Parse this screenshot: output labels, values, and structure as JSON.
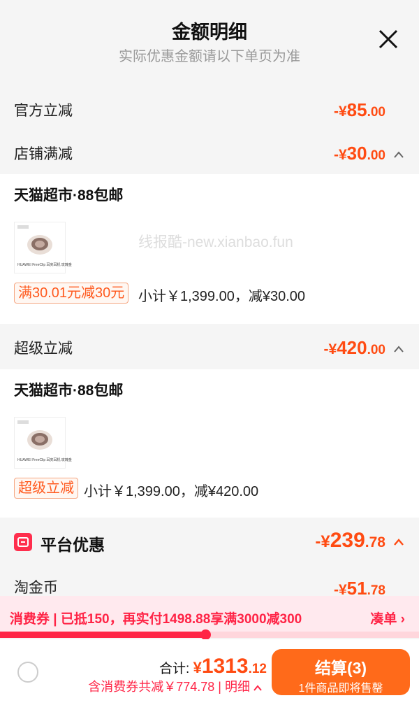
{
  "header": {
    "title": "金额明细",
    "subtitle": "实际优惠金额请以下单页为准"
  },
  "official_discount": {
    "label": "官方立减",
    "sym": "-¥",
    "int": "85",
    "dec": ".00"
  },
  "store_discount": {
    "label": "店铺满减",
    "sym": "-¥",
    "int": "30",
    "dec": ".00"
  },
  "store_panel": {
    "shop_name": "天猫超市·88包邮",
    "product_brand": "HUAWEI FreeClip 耳夹耳机 玫瑰金",
    "tag": "满30.01元减30元",
    "subtotal": "小计￥1,399.00，减¥30.00"
  },
  "super_discount": {
    "label": "超级立减",
    "sym": "-¥",
    "int": "420",
    "dec": ".00"
  },
  "super_panel": {
    "shop_name": "天猫超市·88包邮",
    "product_brand": "HUAWEI FreeClip 耳夹耳机 玫瑰金",
    "tag": "超级立减",
    "subtotal": "小计￥1,399.00，减¥420.00"
  },
  "platform": {
    "label": "平台优惠",
    "sym": "-¥",
    "int": "239",
    "dec": ".78",
    "coin_label": "淘金币",
    "coin_sym": "-¥",
    "coin_int": "51",
    "coin_dec": ".78"
  },
  "coupon_bar": {
    "text": "消费券 | 已抵150，再实付1498.88享满3000减300",
    "link": "凑单 ›",
    "progress": 0.49
  },
  "footer": {
    "total_label": "合计: ",
    "total_sym": "¥",
    "total_int": "1313",
    "total_dec": ".12",
    "saved": "含消费券共减￥774.78 | 明细",
    "checkout_label": "结算(3)",
    "checkout_sub": "1件商品即将售罄"
  },
  "watermark": "线报酷-new.xianbao.fun",
  "colors": {
    "accent": "#ff4b12",
    "coupon_red": "#ff2446",
    "checkout": "#ff6a1a"
  }
}
